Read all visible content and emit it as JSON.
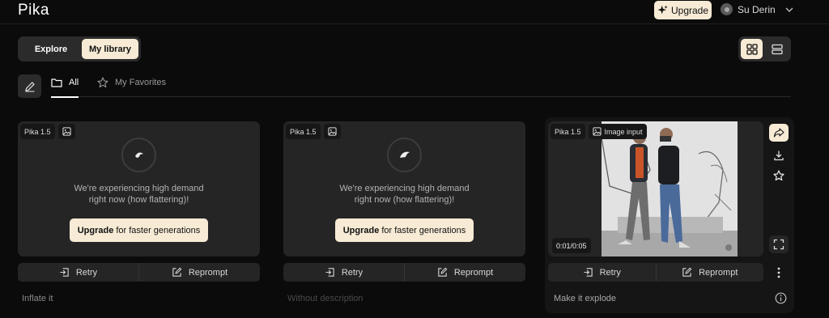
{
  "app": {
    "logo": "Pika"
  },
  "header": {
    "upgrade_label": "Upgrade",
    "user_name": "Su Derin"
  },
  "view_switch": {
    "explore": "Explore",
    "library": "My library",
    "active": "My library"
  },
  "layout_toggle": {
    "active": "grid"
  },
  "tabs": {
    "all": "All",
    "favorites": "My Favorites",
    "active": "All"
  },
  "cards": [
    {
      "model": "Pika 1.5",
      "status_message": "We're experiencing high demand right now (how flattering)!",
      "cta_bold": "Upgrade",
      "cta_rest": "for faster generations",
      "retry": "Retry",
      "reprompt": "Reprompt",
      "caption": "Inflate it"
    },
    {
      "model": "Pika 1.5",
      "status_message": "We're experiencing high demand right now (how flattering)!",
      "cta_bold": "Upgrade",
      "cta_rest": "for faster generations",
      "retry": "Retry",
      "reprompt": "Reprompt",
      "caption": "Without description"
    },
    {
      "model": "Pika 1.5",
      "input_badge": "Image input",
      "time": "0:01/0:05",
      "retry": "Retry",
      "reprompt": "Reprompt",
      "caption": "Make it explode"
    }
  ],
  "colors": {
    "accent": "#f7ebd5",
    "background": "#0b0b0b",
    "card": "#252525"
  }
}
